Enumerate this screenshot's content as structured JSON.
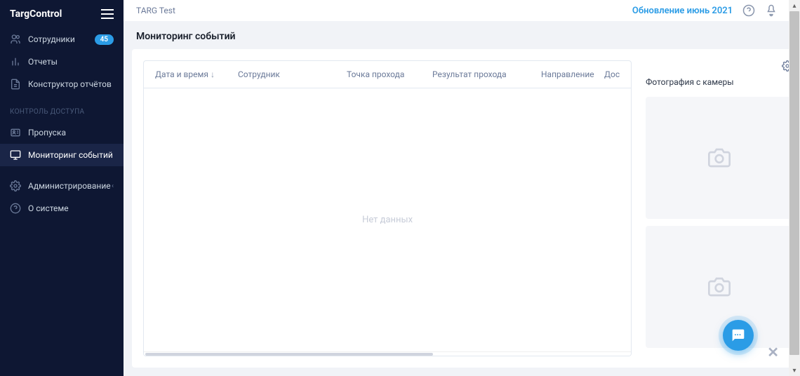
{
  "logo": "TargControl",
  "topbar": {
    "title": "TARG Test",
    "update_link": "Обновление июнь 2021"
  },
  "sidebar": {
    "employees": {
      "label": "Сотрудники",
      "badge": "45"
    },
    "reports": {
      "label": "Отчеты"
    },
    "report_builder": {
      "label": "Конструктор отчётов"
    },
    "section_access": "КОНТРОЛЬ ДОСТУПА",
    "passes": {
      "label": "Пропуска"
    },
    "monitoring": {
      "label": "Мониторинг событий"
    },
    "administration": {
      "label": "Администрирование"
    },
    "about": {
      "label": "О системе"
    }
  },
  "page": {
    "title": "Мониторинг событий"
  },
  "table": {
    "columns": {
      "datetime": "Дата и время",
      "employee": "Сотрудник",
      "point": "Точка прохода",
      "result": "Результат прохода",
      "direction": "Направление",
      "access": "Дос"
    },
    "empty": "Нет данных"
  },
  "panel": {
    "camera_label": "Фотография с камеры"
  }
}
